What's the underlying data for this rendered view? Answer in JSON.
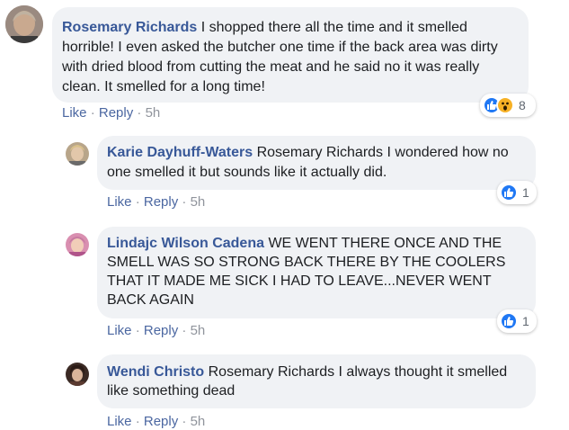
{
  "comments": [
    {
      "author": "Rosemary Richards",
      "text": "I shopped there all the time and it smelled horrible! I even asked the butcher one time if the back area was dirty with dried blood from cutting the meat and he said no it was really clean. It smelled for a long time!",
      "like_label": "Like",
      "reply_label": "Reply",
      "separator": "·",
      "time": "5h",
      "reaction_count": "8",
      "reactions": [
        "like-icon",
        "wow-icon"
      ]
    },
    {
      "author": "Karie Dayhuff-Waters",
      "text": "Rosemary Richards I wondered how no one smelled it but sounds like it actually did.",
      "like_label": "Like",
      "reply_label": "Reply",
      "separator": "·",
      "time": "5h",
      "reaction_count": "1",
      "reactions": [
        "like-icon"
      ]
    },
    {
      "author": "Lindajc Wilson Cadena",
      "text": "WE WENT THERE ONCE AND THE SMELL WAS SO STRONG BACK THERE BY THE COOLERS THAT IT MADE ME SICK I HAD TO LEAVE...NEVER WENT BACK AGAIN",
      "like_label": "Like",
      "reply_label": "Reply",
      "separator": "·",
      "time": "5h",
      "reaction_count": "1",
      "reactions": [
        "like-icon"
      ]
    },
    {
      "author": "Wendi Christo",
      "text": "Rosemary Richards I always thought it smelled like something dead",
      "like_label": "Like",
      "reply_label": "Reply",
      "separator": "·",
      "time": "5h"
    }
  ],
  "colors": {
    "author": "#385898",
    "bubble": "#f0f2f5",
    "action": "#4b67a1",
    "like": "#2078f4",
    "wow": "#f7b125"
  }
}
